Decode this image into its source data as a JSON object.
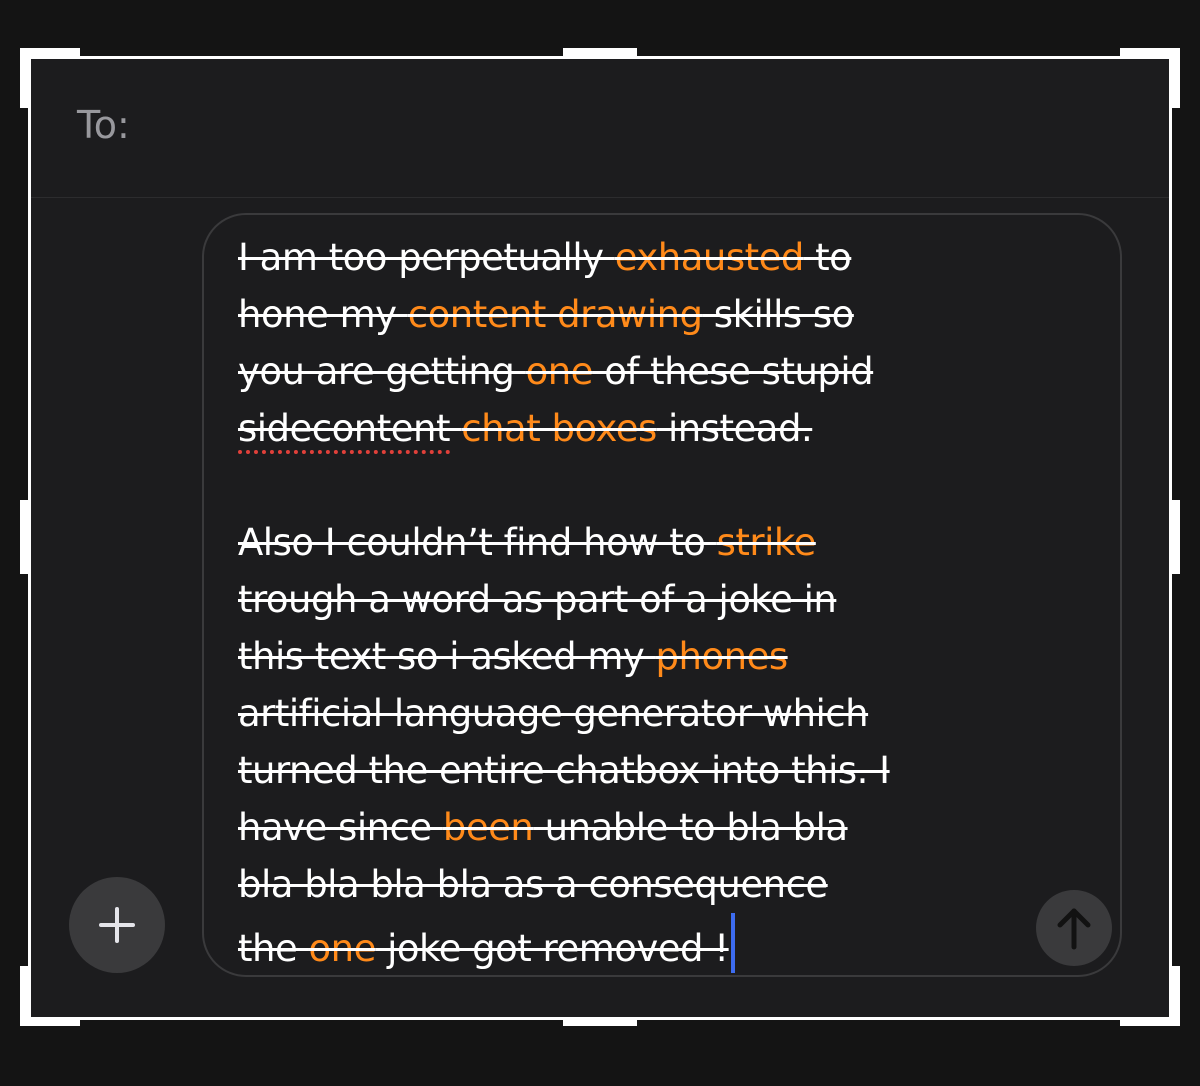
{
  "header": {
    "to_label": "To:"
  },
  "composer": {
    "lines": [
      [
        {
          "t": "I am too perpetually ",
          "h": false
        },
        {
          "t": "exhausted",
          "h": true
        },
        {
          "t": " to",
          "h": false
        }
      ],
      [
        {
          "t": "hone my ",
          "h": false
        },
        {
          "t": "content drawing",
          "h": true
        },
        {
          "t": " skills so",
          "h": false
        }
      ],
      [
        {
          "t": "you are getting ",
          "h": false
        },
        {
          "t": "one",
          "h": true
        },
        {
          "t": " of these stupid",
          "h": false
        }
      ],
      [
        {
          "t": "sidecontent",
          "h": false,
          "misspelled": true
        },
        {
          "t": " ",
          "h": false
        },
        {
          "t": "chat boxes",
          "h": true
        },
        {
          "t": " instead.",
          "h": false
        }
      ],
      [],
      [
        {
          "t": "Also I couldn’t find how to ",
          "h": false
        },
        {
          "t": "strike",
          "h": true
        }
      ],
      [
        {
          "t": "trough a word as part of a joke in",
          "h": false
        }
      ],
      [
        {
          "t": "this text so i asked my ",
          "h": false
        },
        {
          "t": "phones",
          "h": true
        }
      ],
      [
        {
          "t": "artificial language generator which",
          "h": false
        }
      ],
      [
        {
          "t": "turned the entire chatbox into this. I",
          "h": false
        }
      ],
      [
        {
          "t": "have since ",
          "h": false
        },
        {
          "t": "been",
          "h": true
        },
        {
          "t": " unable to bla bla",
          "h": false
        }
      ],
      [
        {
          "t": "bla bla bla bla as a consequence",
          "h": false
        }
      ],
      [
        {
          "t": "the ",
          "h": false
        },
        {
          "t": "one",
          "h": true
        },
        {
          "t": " joke got removed !",
          "h": false
        }
      ]
    ],
    "send_icon": "arrow-up-icon",
    "add_icon": "plus-icon"
  },
  "colors": {
    "background": "#1c1c1e",
    "highlight": "#ff8a1a",
    "caret": "#3d6cf0",
    "spellcheck": "#e0403a"
  }
}
